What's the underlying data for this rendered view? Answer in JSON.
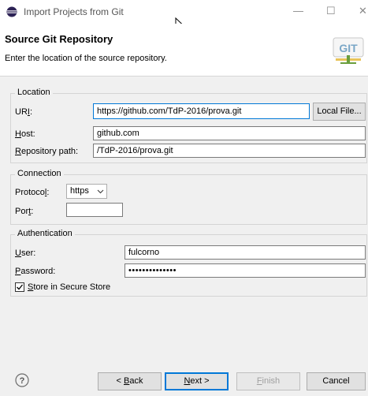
{
  "window": {
    "title": "Import Projects from Git",
    "minimize_glyph": "—",
    "maximize_glyph": "☐",
    "close_glyph": "✕"
  },
  "header": {
    "title": "Source Git Repository",
    "description": "Enter the location of the source repository.",
    "logo_text": "GIT"
  },
  "location": {
    "group_label": "Location",
    "uri_label": "URI:",
    "uri_value": "https://github.com/TdP-2016/prova.git",
    "local_file_button": "Local File...",
    "host_label": "Host:",
    "host_value": "github.com",
    "repo_path_label": "Repository path:",
    "repo_path_value": "/TdP-2016/prova.git"
  },
  "connection": {
    "group_label": "Connection",
    "protocol_label": "Protocol:",
    "protocol_value": "https",
    "port_label": "Port:",
    "port_value": ""
  },
  "authentication": {
    "group_label": "Authentication",
    "user_label": "User:",
    "user_value": "fulcorno",
    "password_label": "Password:",
    "password_value": "••••••••••••••",
    "store_label": "Store in Secure Store",
    "store_checked": true
  },
  "footer": {
    "help_glyph": "?",
    "back_label": "< Back",
    "next_label": "Next >",
    "finish_label": "Finish",
    "cancel_label": "Cancel"
  },
  "colors": {
    "accent": "#0078d7",
    "background": "#f0f0f0"
  },
  "icons": {
    "app": "eclipse-icon",
    "cursor": "mouse-pointer-icon",
    "help": "help-icon",
    "dropdown": "chevron-down-icon",
    "logo": "git-logo"
  }
}
